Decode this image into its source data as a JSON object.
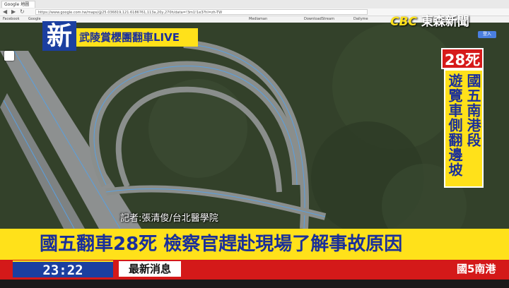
{
  "browser": {
    "tab_title": "Google 地圖",
    "url": "https://www.google.com.tw/maps/@25.036819,121.6186761,113a,20y,270h/data=!3m1!1e3?hl=zh-TW",
    "bookmarks": [
      "Facebook",
      "Google",
      "Mediaman",
      "DownloadStream",
      "Dailyme"
    ],
    "signin_label": "登入"
  },
  "news": {
    "new_badge": "新",
    "live_banner": "武陵賞櫻團翻車LIVE",
    "logo_cbc": "CBC",
    "logo_name": "東森新聞",
    "toll": "28死",
    "vertical_col1": "國五南港段",
    "vertical_col2": "遊覽車側翻邊坡",
    "reporter": "記者:張清俊/台北醫學院",
    "headline": "國五翻車28死 檢察官趕赴現場了解事故原因",
    "clock": "23:22",
    "breaking_label": "最新消息",
    "ticker_text": "國5南港"
  },
  "colors": {
    "yellow": "#ffe11a",
    "blue": "#1a2f9a",
    "red": "#d41919"
  }
}
